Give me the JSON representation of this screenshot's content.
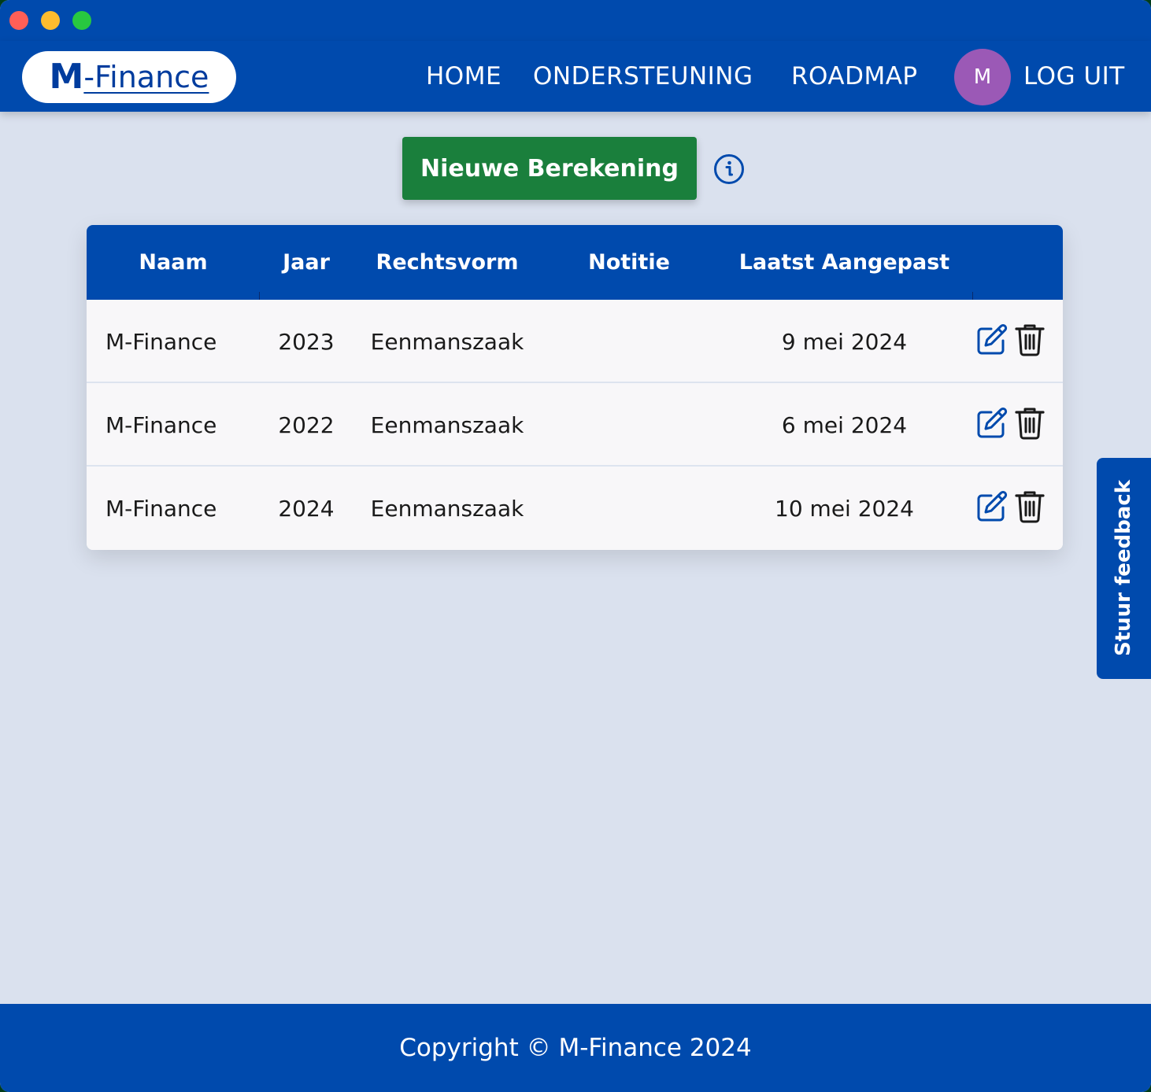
{
  "window": {
    "controls": [
      "close",
      "minimize",
      "maximize"
    ]
  },
  "brand": {
    "logo_mark": "M",
    "logo_text": "-Finance"
  },
  "nav": {
    "home": "HOME",
    "support": "ONDERSTEUNING",
    "roadmap": "ROADMAP",
    "avatar_initial": "M",
    "logout": "LOG UIT"
  },
  "actions": {
    "new_calculation": "Nieuwe Berekening",
    "info_icon": "info-circle"
  },
  "table": {
    "headers": {
      "name": "Naam",
      "year": "Jaar",
      "legal_form": "Rechtsvorm",
      "note": "Notitie",
      "last_modified": "Laatst Aangepast"
    },
    "rows": [
      {
        "name": "M-Finance",
        "year": "2023",
        "legal_form": "Eenmanszaak",
        "note": "",
        "last_modified": "9 mei 2024"
      },
      {
        "name": "M-Finance",
        "year": "2022",
        "legal_form": "Eenmanszaak",
        "note": "",
        "last_modified": "6 mei 2024"
      },
      {
        "name": "M-Finance",
        "year": "2024",
        "legal_form": "Eenmanszaak",
        "note": "",
        "last_modified": "10 mei 2024"
      }
    ],
    "row_actions": [
      "edit-icon",
      "trash-icon"
    ]
  },
  "feedback": {
    "label": "Stuur feedback"
  },
  "footer": {
    "copyright": "Copyright © M-Finance 2024"
  },
  "colors": {
    "primary": "#004aad",
    "success": "#1a7f3c",
    "background": "#dae1ee",
    "avatar": "#9b59b6",
    "row_background": "#f8f7f9"
  }
}
